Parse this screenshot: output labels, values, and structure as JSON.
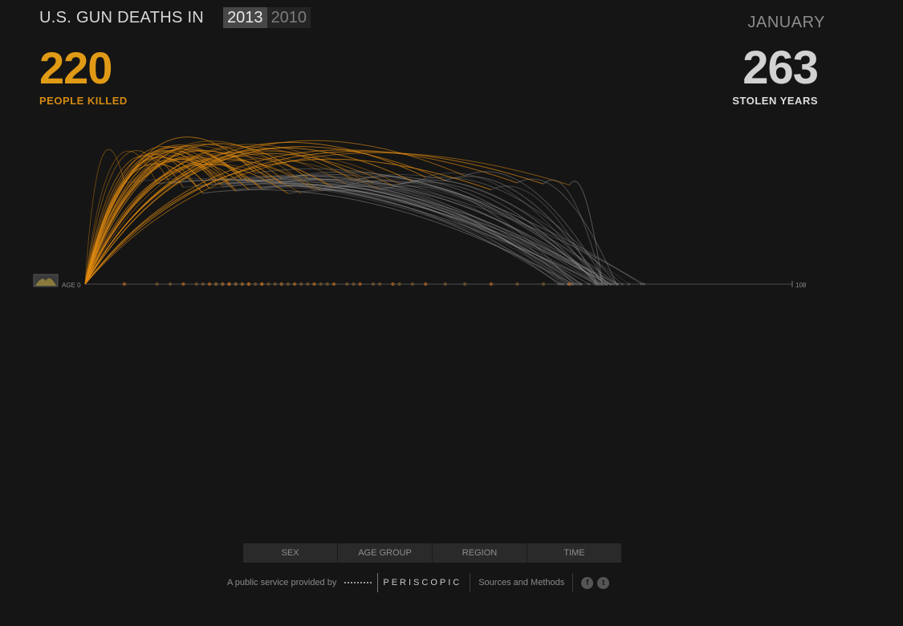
{
  "header": {
    "title": "U.S. GUN DEATHS IN",
    "years": [
      {
        "label": "2013",
        "active": true
      },
      {
        "label": "2010",
        "active": false
      }
    ]
  },
  "stats": {
    "killed_count": "220",
    "killed_label": "PEOPLE KILLED",
    "month": "JANUARY",
    "stolen_years_count": "263",
    "stolen_years_label": "STOLEN YEARS"
  },
  "chart_data": {
    "type": "arc",
    "axis_start_label": "AGE 0",
    "axis_end_label": "108",
    "xlim": [
      0,
      108
    ],
    "colors": {
      "killed": "#e08a10",
      "stolen": "#9a9a9a",
      "axis": "#4a4a4a"
    },
    "victim_ages_sample": [
      6,
      11,
      13,
      15,
      17,
      18,
      19,
      20,
      20,
      21,
      21,
      22,
      22,
      23,
      23,
      24,
      24,
      25,
      25,
      26,
      27,
      27,
      28,
      29,
      30,
      30,
      31,
      32,
      33,
      34,
      35,
      36,
      37,
      38,
      40,
      41,
      42,
      44,
      45,
      47,
      48,
      50,
      52,
      55,
      58,
      62,
      66,
      70,
      74
    ]
  },
  "filters": [
    {
      "label": "SEX"
    },
    {
      "label": "AGE GROUP"
    },
    {
      "label": "REGION"
    },
    {
      "label": "TIME"
    }
  ],
  "footer": {
    "credit": "A public service provided by",
    "brand": "PERISCOPIC",
    "sources": "Sources and Methods",
    "social": [
      {
        "icon": "facebook-icon",
        "glyph": "f"
      },
      {
        "icon": "twitter-icon",
        "glyph": "t"
      }
    ]
  }
}
